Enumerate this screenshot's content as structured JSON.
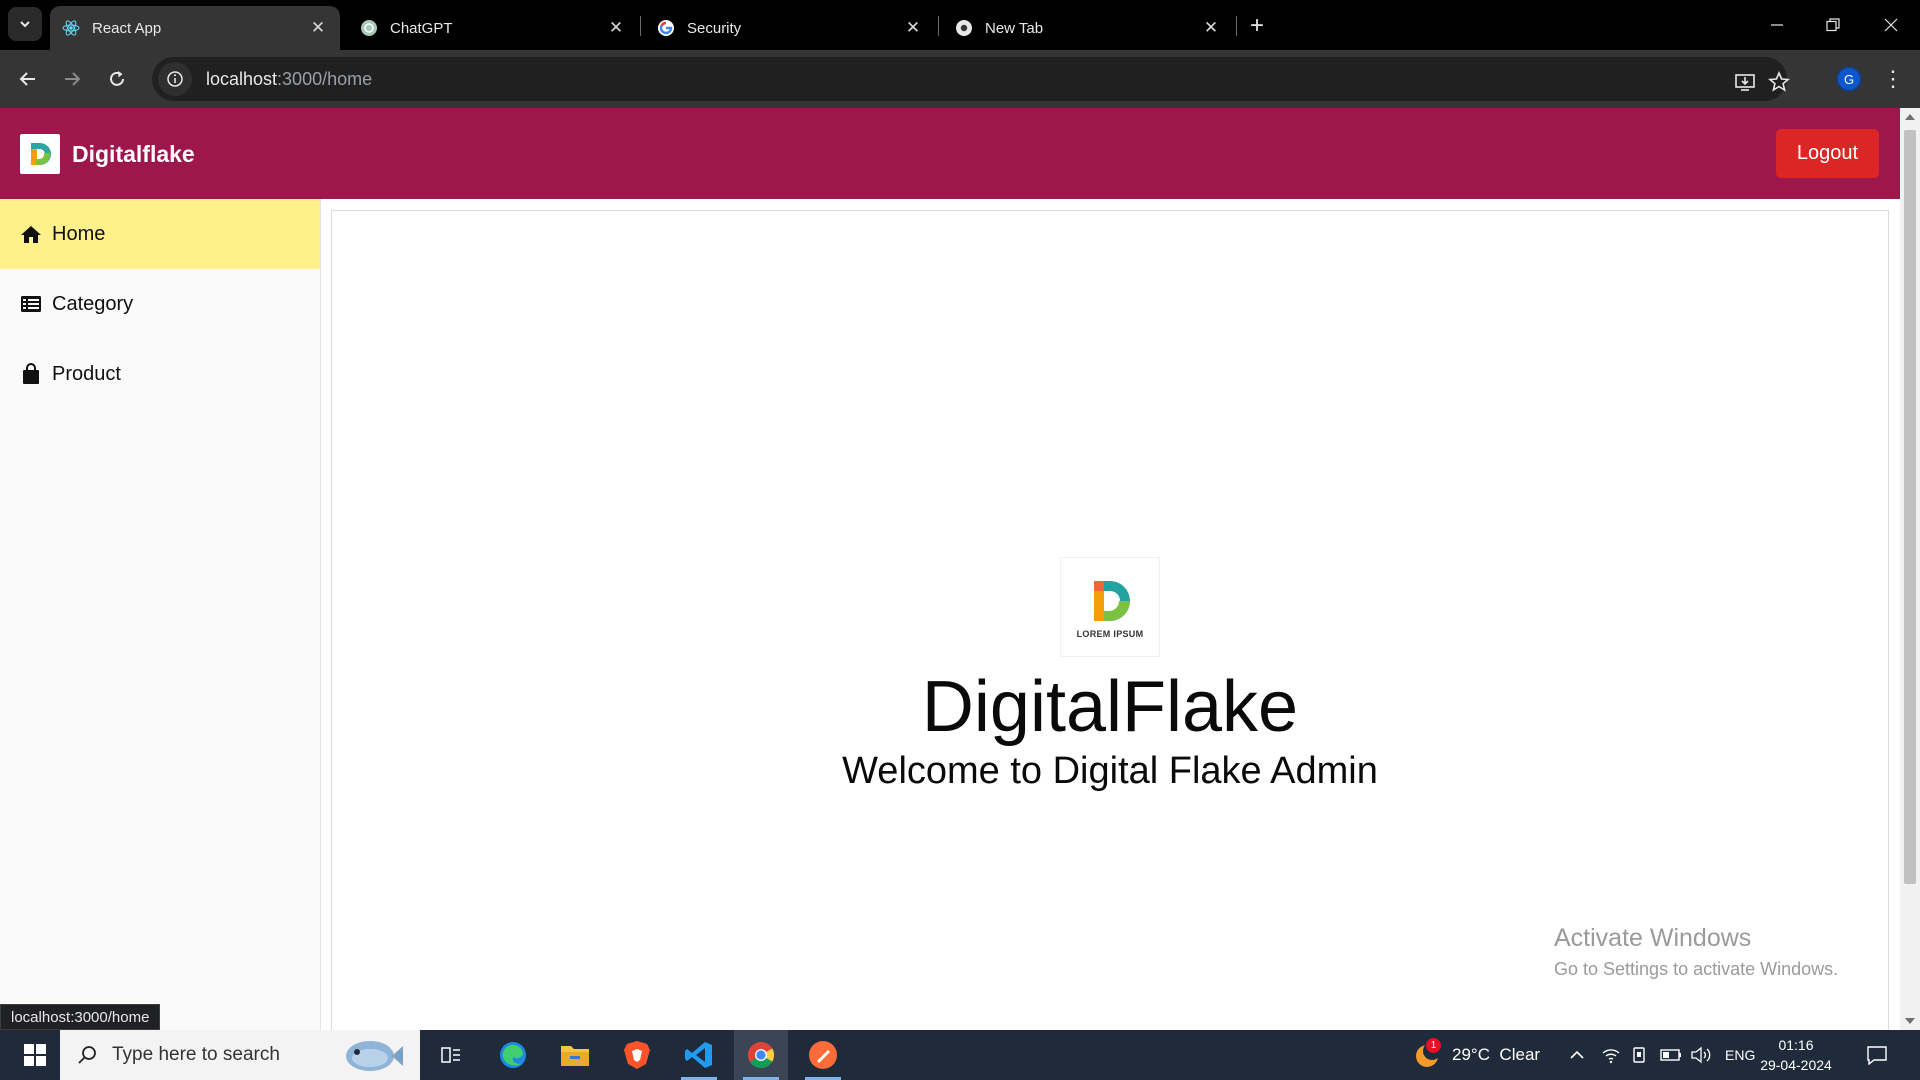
{
  "browser": {
    "tabs": [
      {
        "title": "React App",
        "active": true,
        "icon": "react-icon"
      },
      {
        "title": "ChatGPT",
        "active": false,
        "icon": "chatgpt-icon"
      },
      {
        "title": "Security",
        "active": false,
        "icon": "google-icon"
      },
      {
        "title": "New Tab",
        "active": false,
        "icon": "chrome-icon"
      }
    ],
    "url_host": "localhost",
    "url_path": ":3000/home",
    "profile_initial": "G"
  },
  "app": {
    "brand_name": "Digitalflake",
    "logout_label": "Logout",
    "sidebar": [
      {
        "label": "Home",
        "icon": "home-icon",
        "active": true
      },
      {
        "label": "Category",
        "icon": "list-icon",
        "active": false
      },
      {
        "label": "Product",
        "icon": "shopping-bag-icon",
        "active": false
      }
    ],
    "main": {
      "logo_text": "LOREM IPSUM",
      "title": "DigitalFlake",
      "subtitle": "Welcome to Digital Flake Admin"
    },
    "colors": {
      "header": "#9d174d",
      "active_nav": "#fef08a",
      "logout": "#dc2626"
    }
  },
  "status_tooltip": "localhost:3000/home",
  "watermark": {
    "line1": "Activate Windows",
    "line2": "Go to Settings to activate Windows."
  },
  "taskbar": {
    "search_placeholder": "Type here to search",
    "weather_badge": "1",
    "weather": "29°C  Clear",
    "language": "ENG",
    "time": "01:16",
    "date": "29-04-2024"
  }
}
